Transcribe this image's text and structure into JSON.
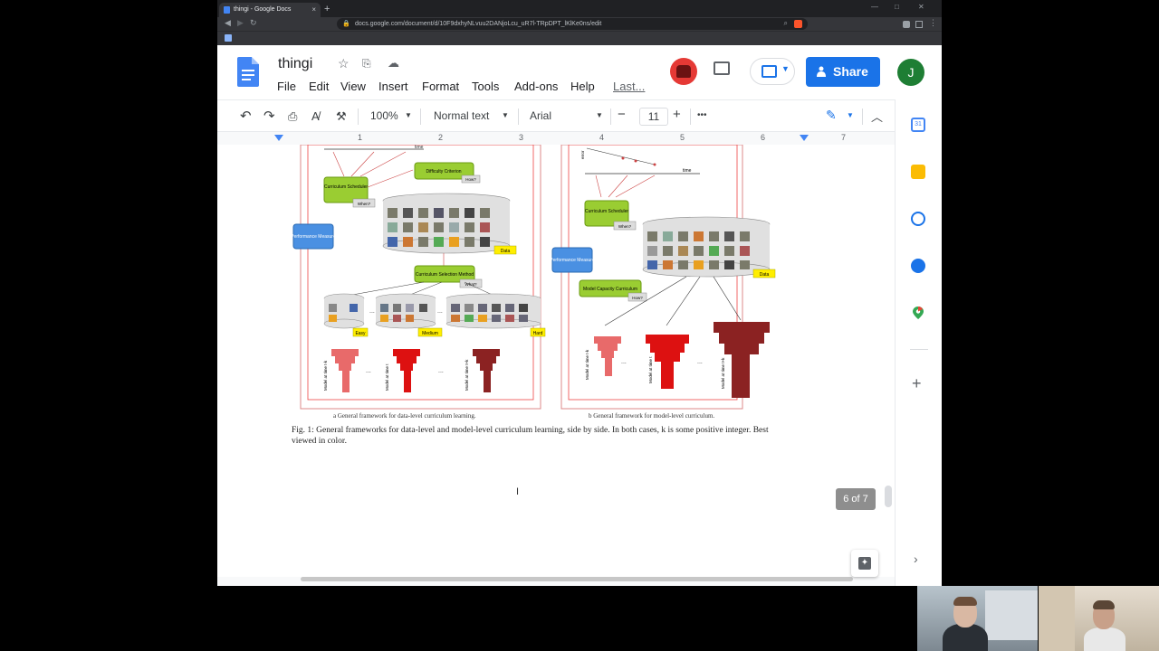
{
  "browser": {
    "tab_title": "thingi - Google Docs",
    "tab_close": "×",
    "new_tab": "+",
    "url": "docs.google.com/document/d/10F9dxhyNLvuu2DANjoLcu_uR7l-TRpDPT_lKlKe0ns/edit"
  },
  "docs": {
    "title": "thingi",
    "menu": [
      "File",
      "Edit",
      "View",
      "Insert",
      "Format",
      "Tools",
      "Add-ons",
      "Help"
    ],
    "last_edit": "Last...",
    "share_label": "Share",
    "avatar_letter": "J"
  },
  "toolbar": {
    "zoom": "100%",
    "style": "Normal text",
    "font": "Arial",
    "font_size": "11",
    "minus": "−",
    "plus": "+",
    "more": "•••"
  },
  "ruler": {
    "numbers": [
      "1",
      "2",
      "3",
      "4",
      "5",
      "6",
      "7"
    ]
  },
  "figure": {
    "left": {
      "difficulty_criterion": "Difficulty Criterion",
      "how": "How?",
      "curriculum_scheduler": "Curriculum Scheduler",
      "when": "When?",
      "performance_measure": "Performance Measure",
      "data": "Data",
      "selection_method": "Curriculum Selection Method",
      "what": "What?",
      "easy": "Easy",
      "medium": "Medium",
      "hard": "Hard",
      "model_t_minus_k": "Model at time t-k",
      "model_t": "Model at time t",
      "model_t_plus_k": "Model at time t+k",
      "caption": "a General framework for data-level curriculum learning.",
      "time": "time"
    },
    "right": {
      "curriculum_scheduler": "Curriculum Scheduler",
      "when": "When?",
      "performance_measure": "Performance Measure",
      "data": "Data",
      "model_capacity": "Model Capacity Curriculum",
      "how": "How?",
      "error": "error",
      "time": "time",
      "model_t_minus_k": "Model at time t-k",
      "model_t": "Model at time t",
      "model_t_plus_k": "Model at time t+k",
      "caption": "b General framework for model-level curriculum."
    },
    "fig_caption": "Fig. 1: General frameworks for data-level and model-level curriculum learning, side by side. In both cases, k is some positive integer. Best viewed in color."
  },
  "page_indicator": "6 of 7",
  "icons": [
    "docs-icon",
    "star-icon",
    "move-icon",
    "cloud-icon",
    "undo-icon",
    "redo-icon",
    "print-icon",
    "spellcheck-icon",
    "paint-format-icon",
    "pencil-icon",
    "collapse-icon",
    "calendar-icon",
    "keep-icon",
    "tasks-icon",
    "contacts-icon",
    "maps-icon",
    "add-icon",
    "explore-icon"
  ],
  "colors": {
    "accent": "#1a73e8",
    "green_box": "#9acd32",
    "blue_box": "#4a90e2",
    "yellow_tag": "#ffee00",
    "red_model": "#cc2222"
  }
}
